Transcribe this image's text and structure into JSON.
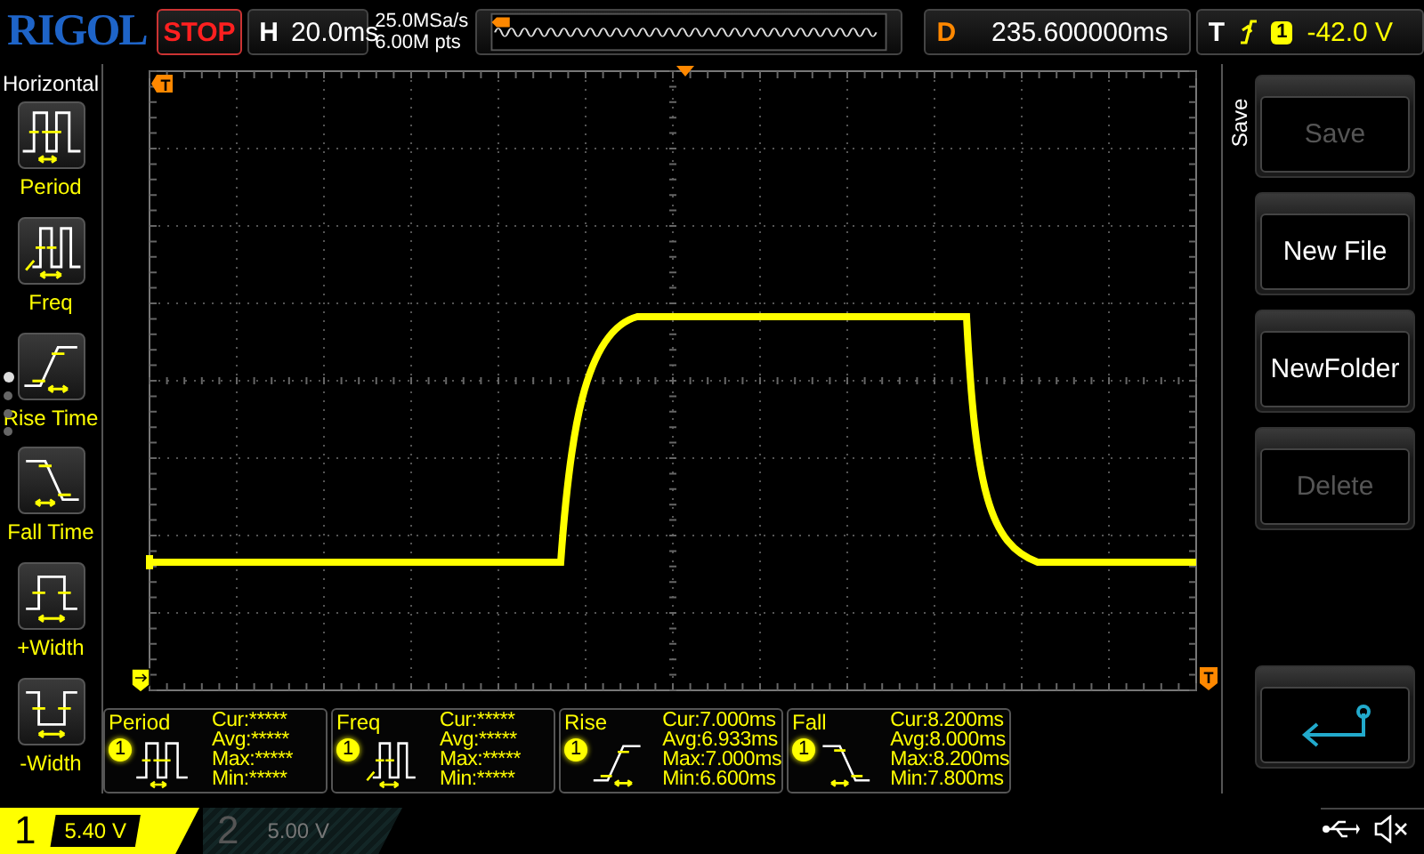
{
  "header": {
    "logo": "RIGOL",
    "run_state": "STOP",
    "timebase": {
      "label": "H",
      "value": "20.0ms"
    },
    "sample_rate": "25.0MSa/s",
    "memory_depth": "6.00M pts",
    "delay": {
      "label": "D",
      "value": "235.600000ms"
    },
    "trigger": {
      "label": "T",
      "channel": "1",
      "level": "-42.0 V"
    }
  },
  "left_menu": {
    "title": "Horizontal",
    "items": [
      {
        "label": "Period",
        "kind": "period"
      },
      {
        "label": "Freq",
        "kind": "freq"
      },
      {
        "label": "Rise Time",
        "kind": "rise"
      },
      {
        "label": "Fall Time",
        "kind": "fall"
      },
      {
        "label": "+Width",
        "kind": "pwidth"
      },
      {
        "label": "-Width",
        "kind": "nwidth"
      }
    ],
    "pages": [
      {
        "selected": true
      },
      {
        "selected": false
      },
      {
        "selected": false
      },
      {
        "selected": false
      }
    ]
  },
  "screen": {
    "trigger_marker": "T",
    "level_marker": "T"
  },
  "measurements": [
    {
      "name": "Period",
      "channel": "1",
      "kind": "period",
      "lines": [
        "Cur:*****",
        "Avg:*****",
        "Max:*****",
        "Min:*****"
      ]
    },
    {
      "name": "Freq",
      "channel": "1",
      "kind": "freq",
      "lines": [
        "Cur:*****",
        "Avg:*****",
        "Max:*****",
        "Min:*****"
      ]
    },
    {
      "name": "Rise",
      "channel": "1",
      "kind": "rise",
      "lines": [
        "Cur:7.000ms",
        "Avg:6.933ms",
        "Max:7.000ms",
        "Min:6.600ms"
      ]
    },
    {
      "name": "Fall",
      "channel": "1",
      "kind": "fall",
      "lines": [
        "Cur:8.200ms",
        "Avg:8.000ms",
        "Max:8.200ms",
        "Min:7.800ms"
      ]
    }
  ],
  "right_menu": {
    "title": "Save",
    "items": [
      {
        "kind": "text",
        "label": "Save",
        "disabled": true
      },
      {
        "kind": "text",
        "label": "New File",
        "disabled": false
      },
      {
        "kind": "text",
        "label": "NewFolder",
        "disabled": false
      },
      {
        "kind": "text",
        "label": "Delete",
        "disabled": true
      },
      {
        "kind": "back",
        "disabled": false
      }
    ]
  },
  "channels": [
    {
      "number": "1",
      "scale": "5.40 V",
      "selected": true
    },
    {
      "number": "2",
      "scale": "5.00 V",
      "selected": false
    }
  ]
}
